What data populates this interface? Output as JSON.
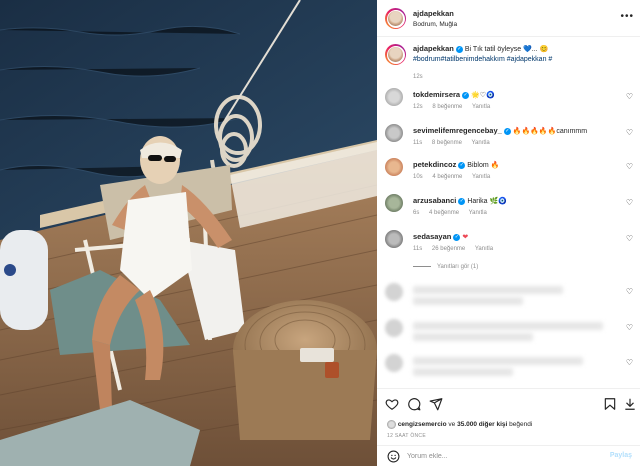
{
  "header": {
    "username": "ajdapekkan",
    "location": "Bodrum, Muğla"
  },
  "caption": {
    "username": "ajdapekkan",
    "text": "Bi Tık tatil öyleyse 💙... 😊",
    "hashtags": "#bodrum#tatilbenimdehakkım #ajdapekkan #",
    "time": "12s"
  },
  "comments": [
    {
      "username": "tokdemirsera",
      "text": "🌟♡🧿",
      "time": "12s",
      "likes": "8 beğenme",
      "reply": "Yanıtla"
    },
    {
      "username": "sevimelifemregencebay_",
      "text": "🔥🔥🔥🔥🔥canımmm",
      "time": "11s",
      "likes": "8 beğenme",
      "reply": "Yanıtla"
    },
    {
      "username": "petekdincoz",
      "text": "Biblom 🔥",
      "time": "10s",
      "likes": "4 beğenme",
      "reply": "Yanıtla"
    },
    {
      "username": "arzusabanci",
      "text": "Harika 🌿🧿",
      "time": "6s",
      "likes": "4 beğenme",
      "reply": "Yanıtla"
    },
    {
      "username": "sedasayan",
      "text": "❤",
      "time": "11s",
      "likes": "26 beğenme",
      "reply": "Yanıtla"
    }
  ],
  "view_replies": "Yanıtları gör (1)",
  "likes": {
    "user": "cengizsemercio",
    "connector": "ve",
    "count": "35.000 diğer kişi",
    "suffix": "beğendi"
  },
  "timeago": "12 SAAT ÖNCE",
  "add_comment": {
    "placeholder": "Yorum ekle...",
    "post_label": "Paylaş"
  },
  "icons": [
    "heart-icon",
    "comment-icon",
    "share-icon",
    "save-icon",
    "more-icon",
    "smile-icon",
    "verified-icon"
  ],
  "colors": {
    "link": "#00376b",
    "verified": "#0095f6",
    "post_disabled": "#b2dffc"
  }
}
